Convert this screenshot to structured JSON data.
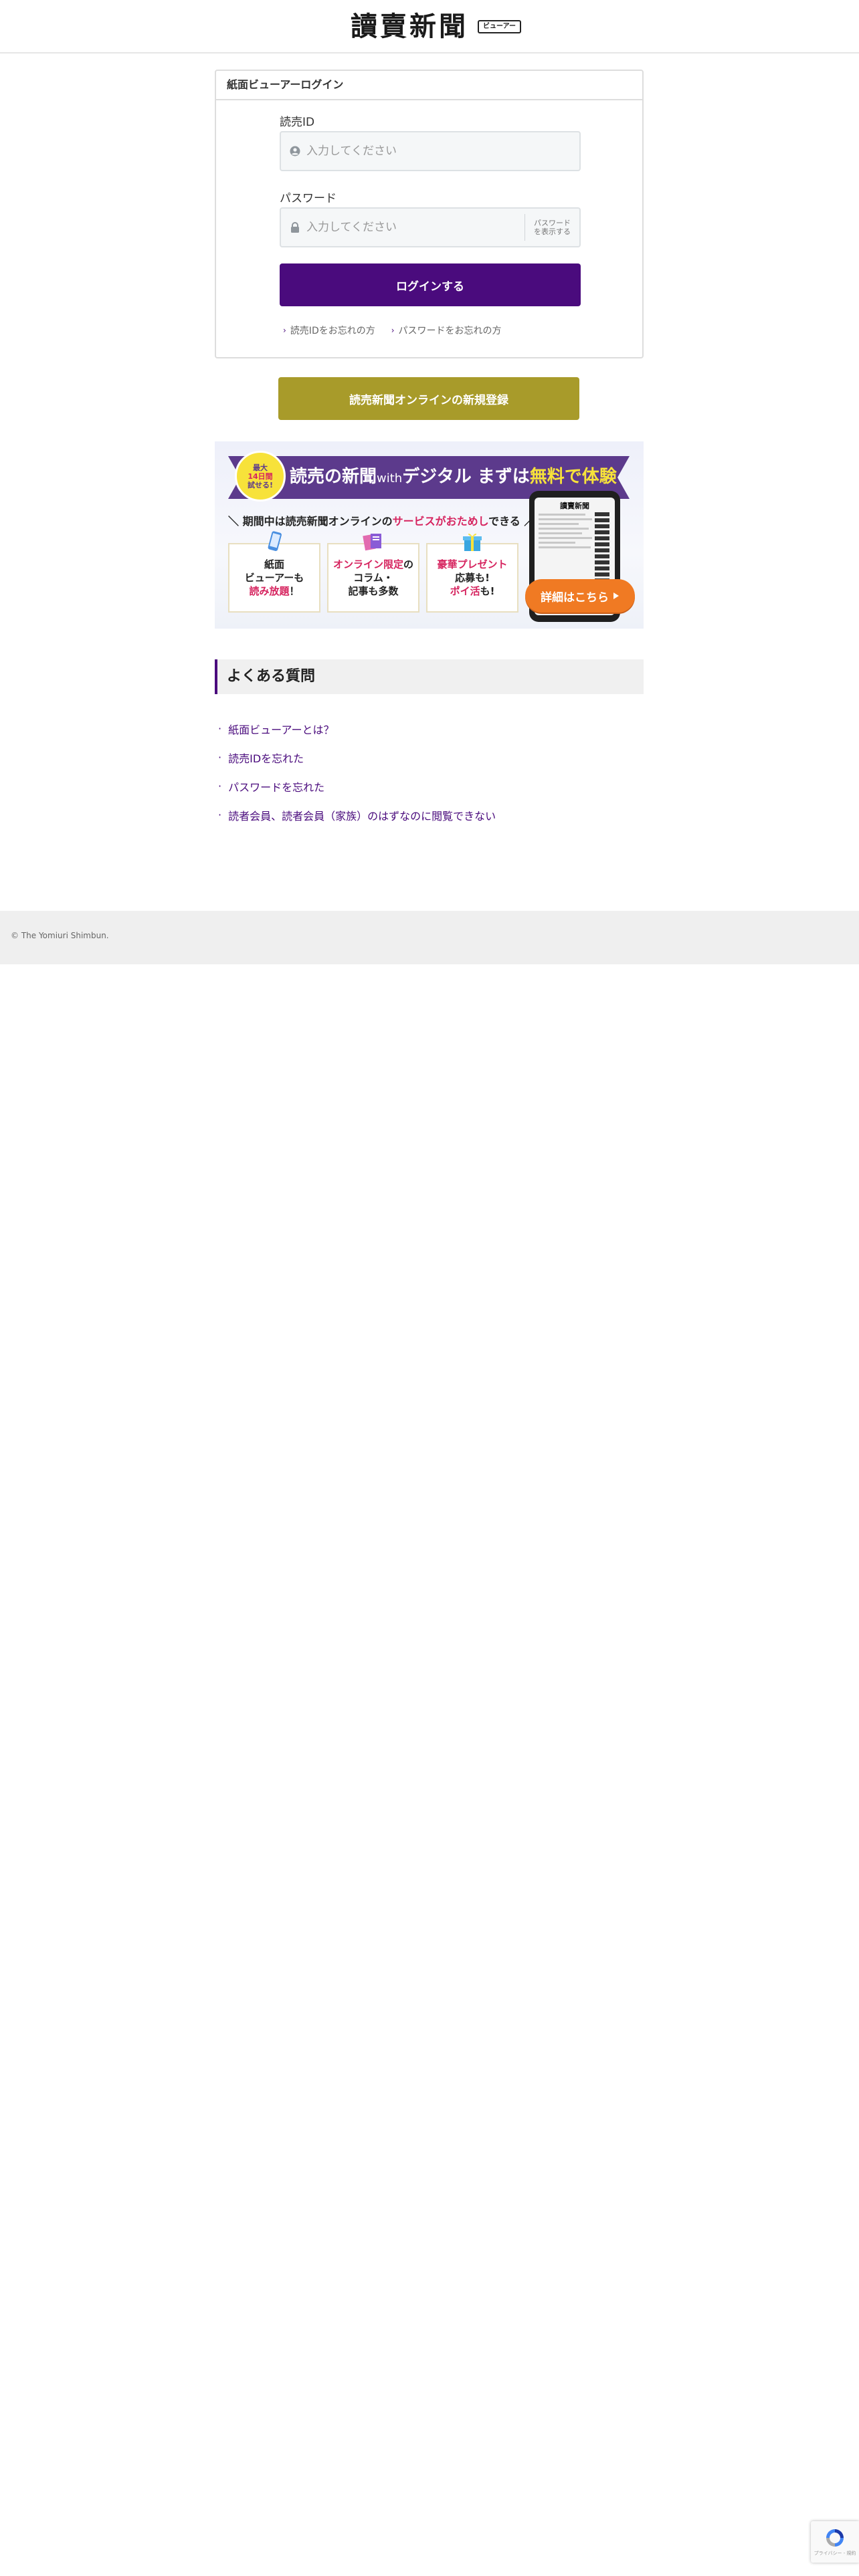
{
  "header": {
    "logo_text": "讀賣新聞",
    "badge": "ビューアー"
  },
  "login": {
    "card_title": "紙面ビューアーログイン",
    "id_label": "読売ID",
    "id_placeholder": "入力してください",
    "password_label": "パスワード",
    "password_placeholder": "入力してください",
    "show_password_line1": "パスワード",
    "show_password_line2": "を表示する",
    "submit_label": "ログインする",
    "forgot_id": "読売IDをお忘れの方",
    "forgot_password": "パスワードをお忘れの方"
  },
  "register": {
    "label": "読売新聞オンラインの新規登録"
  },
  "banner": {
    "circle_line1": "最大",
    "circle_line2": "14日間",
    "circle_line3": "試せる!",
    "title_part1": "読売の新聞",
    "title_with": "with",
    "title_part2": "デジタル まずは",
    "title_highlight": "無料で体験",
    "sub_prefix": "＼ 期間中は読売新聞オンラインの",
    "sub_highlight": "サービスがおためし",
    "sub_suffix": "できる ／",
    "feature1_line1": "紙面",
    "feature1_line2": "ビューアーも",
    "feature1_line3": "読み放題",
    "feature1_line3b": "！",
    "feature2_line1": "オンライン限定",
    "feature2_line1b": "の",
    "feature2_line2": "コラム・",
    "feature2_line3": "記事も多数",
    "feature3_line1": "豪華プレゼント",
    "feature3_line2": "応募も!",
    "feature3_line3": "ポイ活",
    "feature3_line3b": "も!",
    "phone_paper_title": "讀賣新聞",
    "detail_label": "詳細はこちら",
    "accent_color": "#5c3a8c",
    "cta_color": "#f07a23"
  },
  "faq": {
    "title": "よくある質問",
    "items": [
      "紙面ビューアーとは？",
      "読売IDを忘れた",
      "パスワードを忘れた",
      "読者会員、読者会員（家族）のはずなのに閲覧できない"
    ]
  },
  "footer": {
    "copyright": "© The Yomiuri Shimbun."
  },
  "recaptcha": {
    "text": "プライバシー - 規約"
  },
  "colors": {
    "primary": "#4a0b7d",
    "register": "#a89b2a",
    "footer_bg": "#efefef"
  },
  "icons": {
    "id_field": "user-circle-icon",
    "password_field": "lock-icon",
    "bullet": "chevron-right-icon",
    "detail_arrow": "triangle-right-icon",
    "recaptcha": "recaptcha-logo-icon"
  }
}
